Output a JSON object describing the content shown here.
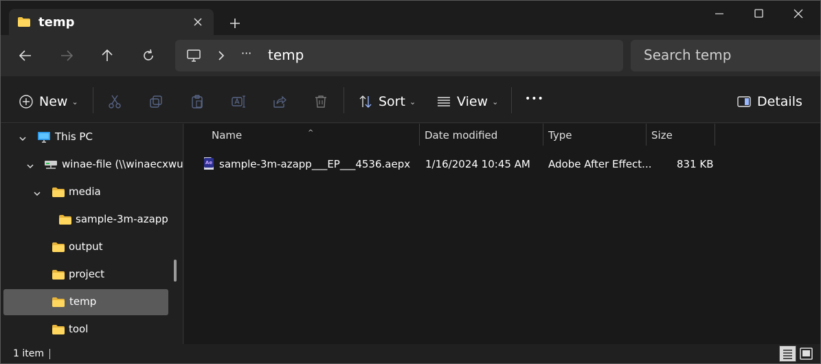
{
  "tab": {
    "title": "temp"
  },
  "address": {
    "crumb": "temp",
    "overflow": "···"
  },
  "search": {
    "placeholder": "Search temp"
  },
  "toolbar": {
    "new_label": "New",
    "sort_label": "Sort",
    "view_label": "View",
    "more_label": "•••",
    "details_label": "Details"
  },
  "sidebar": {
    "items": [
      {
        "label": "This PC",
        "icon": "monitor-icon"
      },
      {
        "label": "winae-file (\\\\winaecxwu",
        "icon": "network-drive-icon"
      },
      {
        "label": "media",
        "icon": "folder-icon"
      },
      {
        "label": "sample-3m-azapp",
        "icon": "folder-icon"
      },
      {
        "label": "output",
        "icon": "folder-icon"
      },
      {
        "label": "project",
        "icon": "folder-icon"
      },
      {
        "label": "temp",
        "icon": "folder-icon",
        "selected": true
      },
      {
        "label": "tool",
        "icon": "folder-icon"
      }
    ]
  },
  "columns": {
    "name": "Name",
    "date": "Date modified",
    "type": "Type",
    "size": "Size"
  },
  "files": [
    {
      "name": "sample-3m-azapp___EP___4536.aepx",
      "date": "1/16/2024 10:45 AM",
      "type": "Adobe After Effect...",
      "size": "831 KB",
      "icon": "after-effects-file-icon"
    }
  ],
  "status": {
    "count": "1 item"
  },
  "colors": {
    "folder": "#f5c542",
    "selection": "#5a5a5a",
    "ae_icon": "#2b2f8f"
  }
}
